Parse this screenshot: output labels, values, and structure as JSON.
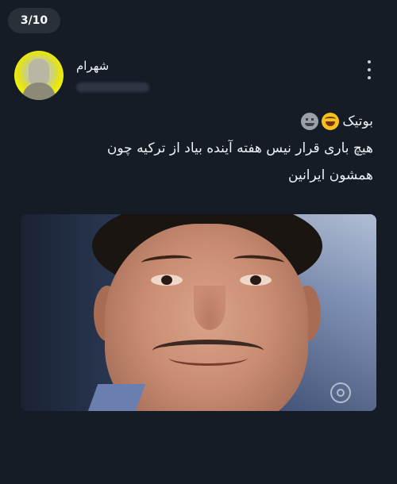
{
  "viewer": {
    "counter": "3/10"
  },
  "post": {
    "author": {
      "name": "شهرام"
    },
    "caption": {
      "line1": "بوتیک",
      "line2": "هیچ باری قرار نیس هفته آینده بیاد از ترکیه چون",
      "line3": "همشون ایرانین",
      "emojis": [
        "laughing-sweat-emoji",
        "grinning-gray-emoji"
      ]
    },
    "media": {
      "type": "image",
      "description_icon": "face-photo"
    }
  }
}
